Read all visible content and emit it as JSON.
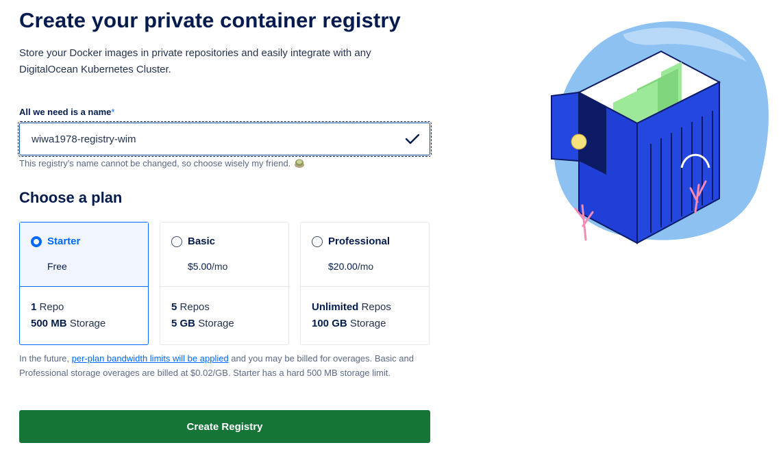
{
  "page": {
    "title": "Create your private container registry",
    "subtitle": "Store your Docker images in private repositories and easily integrate with any DigitalOcean Kubernetes Cluster."
  },
  "name_field": {
    "label": "All we need is a name",
    "required_marker": "*",
    "value": "wiwa1978-registry-wim",
    "hint": "This registry's name cannot be changed, so choose wisely my friend.",
    "valid_icon": "check-icon",
    "hint_icon": "turtle-icon"
  },
  "plans": {
    "heading": "Choose a plan",
    "items": [
      {
        "name": "Starter",
        "price": "Free",
        "price_suffix": "",
        "selected": true,
        "repos_value": "1",
        "repos_label": "Repo",
        "storage_value": "500 MB",
        "storage_label": "Storage"
      },
      {
        "name": "Basic",
        "price": "$5.00",
        "price_suffix": "/mo",
        "selected": false,
        "repos_value": "5",
        "repos_label": "Repos",
        "storage_value": "5 GB",
        "storage_label": "Storage"
      },
      {
        "name": "Professional",
        "price": "$20.00",
        "price_suffix": "/mo",
        "selected": false,
        "repos_value": "Unlimited",
        "repos_label": "Repos",
        "storage_value": "100 GB",
        "storage_label": "Storage"
      }
    ]
  },
  "note": {
    "before_link": "In the future, ",
    "link_text": "per-plan bandwidth limits will be applied",
    "after_link": " and you may be billed for overages. Basic and Professional storage overages are billed at $0.02/GB. Starter has a hard 500 MB storage limit."
  },
  "create_button": {
    "label": "Create Registry"
  },
  "colors": {
    "brand_blue": "#0069ff",
    "navy": "#031b4e",
    "create_green": "#157537",
    "illustration_sky": "#7fb8f0",
    "illustration_container": "#1f3fd6",
    "illustration_green": "#9ee89a"
  }
}
